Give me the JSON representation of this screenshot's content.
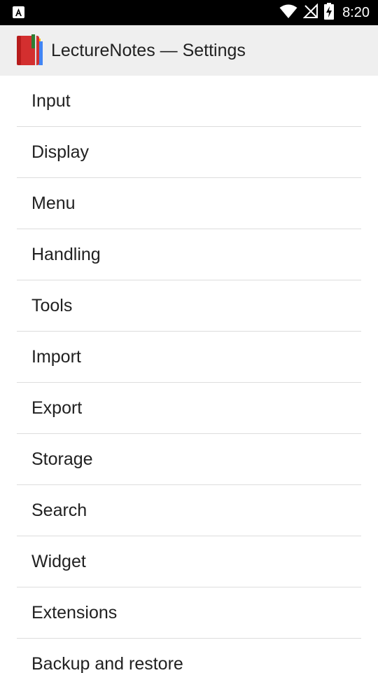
{
  "status_bar": {
    "time": "8:20",
    "icons": [
      "accessibility-a-icon",
      "wifi-icon",
      "no-signal-icon",
      "battery-charging-icon"
    ]
  },
  "app_bar": {
    "title": "LectureNotes — Settings",
    "icon": "lecturenotes-app-icon"
  },
  "settings": {
    "items": [
      {
        "label": "Input"
      },
      {
        "label": "Display"
      },
      {
        "label": "Menu"
      },
      {
        "label": "Handling"
      },
      {
        "label": "Tools"
      },
      {
        "label": "Import"
      },
      {
        "label": "Export"
      },
      {
        "label": "Storage"
      },
      {
        "label": "Search"
      },
      {
        "label": "Widget"
      },
      {
        "label": "Extensions"
      },
      {
        "label": "Backup and restore"
      }
    ]
  },
  "colors": {
    "status_bar_bg": "#000000",
    "app_bar_bg": "#efefef",
    "text": "#212121",
    "divider": "#dddddd"
  }
}
